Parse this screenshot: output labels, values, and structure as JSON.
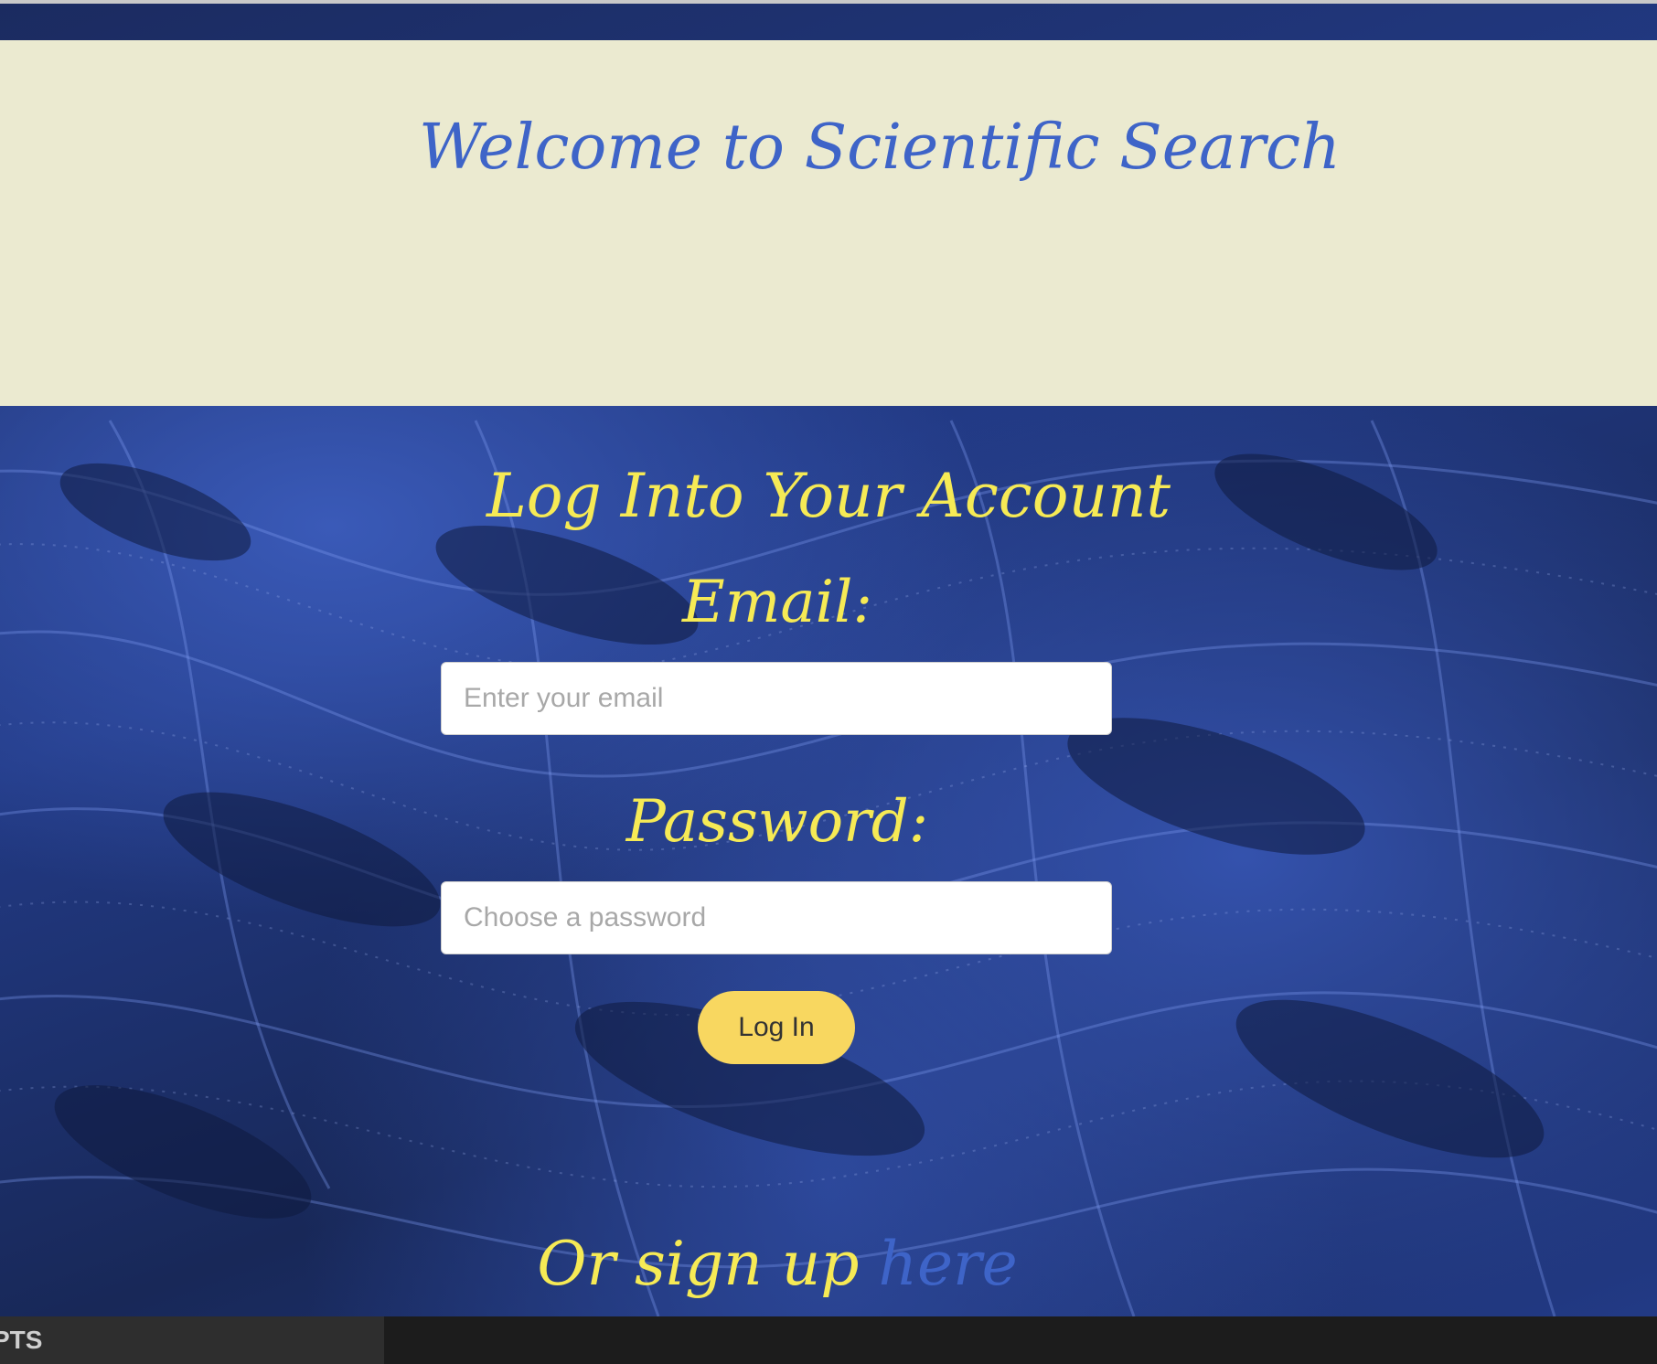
{
  "header": {
    "title": "Welcome to Scientific Search"
  },
  "login": {
    "title": "Log Into Your Account",
    "email_label": "Email:",
    "email_placeholder": "Enter your email",
    "password_label": "Password:",
    "password_placeholder": "Choose a password",
    "button_label": "Log In",
    "signup_prefix": "Or sign up ",
    "signup_link": "here"
  },
  "taskbar": {
    "tab_label": "PTS"
  },
  "colors": {
    "header_bg": "#ebead0",
    "title_blue": "#3e64c8",
    "label_yellow": "#f6ea55",
    "button_yellow": "#f8d760"
  }
}
